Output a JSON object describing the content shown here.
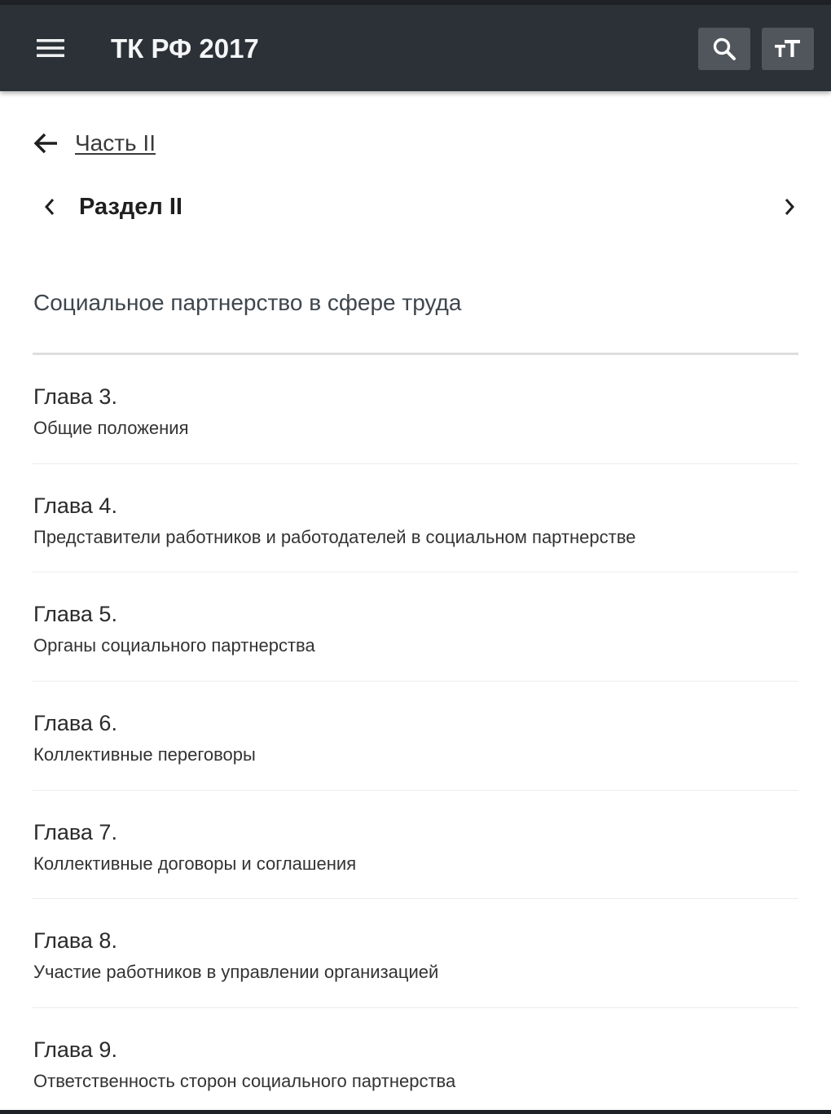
{
  "app_bar": {
    "title": "ТК РФ 2017",
    "menu_icon": "hamburger-menu-icon",
    "search_icon": "search-icon",
    "text_size_icon": "text-size-icon",
    "background_color": "#2b3137",
    "button_color": "#50565c"
  },
  "navigation": {
    "back_label": "Часть II",
    "back_icon": "arrow-left-icon",
    "section_title": "Раздел II",
    "prev_icon": "chevron-left-icon",
    "next_icon": "chevron-right-icon"
  },
  "section": {
    "subtitle": "Социальное партнерство в сфере труда"
  },
  "chapters": [
    {
      "title": "Глава 3.",
      "description": "Общие положения"
    },
    {
      "title": "Глава 4.",
      "description": "Представители работников и работодателей в социальном партнерстве"
    },
    {
      "title": "Глава 5.",
      "description": "Органы социального партнерства"
    },
    {
      "title": "Глава 6.",
      "description": "Коллективные переговоры"
    },
    {
      "title": "Глава 7.",
      "description": "Коллективные договоры и соглашения"
    },
    {
      "title": "Глава 8.",
      "description": "Участие работников в управлении организацией"
    },
    {
      "title": "Глава 9.",
      "description": "Ответственность сторон социального партнерства"
    }
  ]
}
